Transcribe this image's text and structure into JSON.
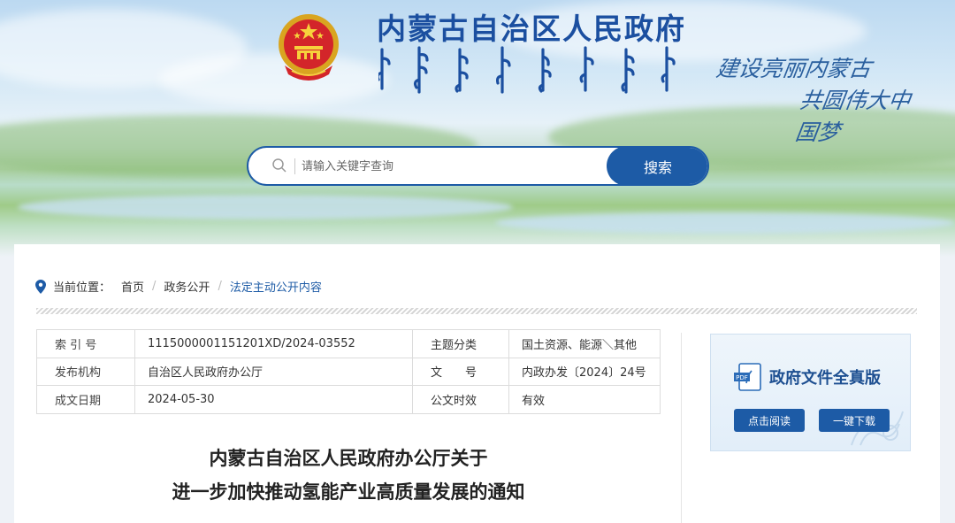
{
  "header": {
    "site_title": "内蒙古自治区人民政府",
    "mongolian_title_image": "mongolian-script-title",
    "slogan_line1": "建设亮丽内蒙古",
    "slogan_line2": "共圆伟大中国梦",
    "emblem_icon": "national-emblem-icon"
  },
  "search": {
    "placeholder": "请输入关键字查询",
    "button_label": "搜索",
    "icon": "search-icon"
  },
  "breadcrumb": {
    "label": "当前位置：",
    "items": [
      "首页",
      "政务公开",
      "法定主动公开内容"
    ],
    "icon": "location-pin-icon"
  },
  "meta_table": [
    {
      "k1": "索 引 号",
      "v1": "1115000001151201XD/2024-03552",
      "k2": "主题分类",
      "v2": "国土资源、能源＼其他"
    },
    {
      "k1": "发布机构",
      "v1": "自治区人民政府办公厅",
      "k2": "文　　号",
      "v2": "内政办发〔2024〕24号"
    },
    {
      "k1": "成文日期",
      "v1": "2024-05-30",
      "k2": "公文时效",
      "v2": "有效"
    }
  ],
  "document": {
    "title_line1": "内蒙古自治区人民政府办公厅关于",
    "title_line2": "进一步加快推动氢能产业高质量发展的通知"
  },
  "side_panel": {
    "title": "政府文件全真版",
    "icon": "pdf-icon",
    "read_label": "点击阅读",
    "download_label": "一键下载"
  },
  "colors": {
    "brand_blue": "#1d5ba6",
    "title_blue": "#1b4fa0"
  }
}
